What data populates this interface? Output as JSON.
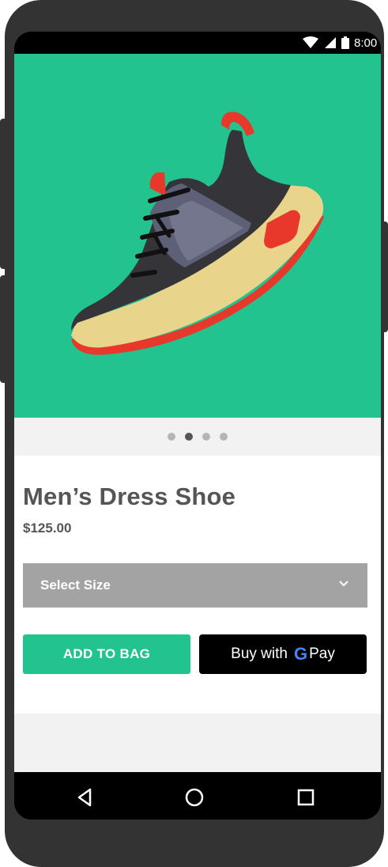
{
  "status_bar": {
    "time": "8:00",
    "icons": [
      "wifi-icon",
      "signal-icon",
      "battery-icon"
    ]
  },
  "product": {
    "title": "Men’s Dress Shoe",
    "price": "$125.00",
    "image_dots": {
      "count": 4,
      "active_index": 1
    }
  },
  "size_select": {
    "label": "Select Size",
    "icon": "chevron-down-icon"
  },
  "actions": {
    "add_to_bag_label": "ADD TO BAG",
    "gpay_prefix": "Buy with",
    "gpay_g": "G",
    "gpay_suffix": "Pay"
  },
  "navigation": [
    "back-icon",
    "home-icon",
    "recents-icon"
  ],
  "colors": {
    "accent": "#22c38e",
    "select_bg": "#a3a3a3",
    "text": "#555555",
    "gpay_bg": "#000000"
  }
}
